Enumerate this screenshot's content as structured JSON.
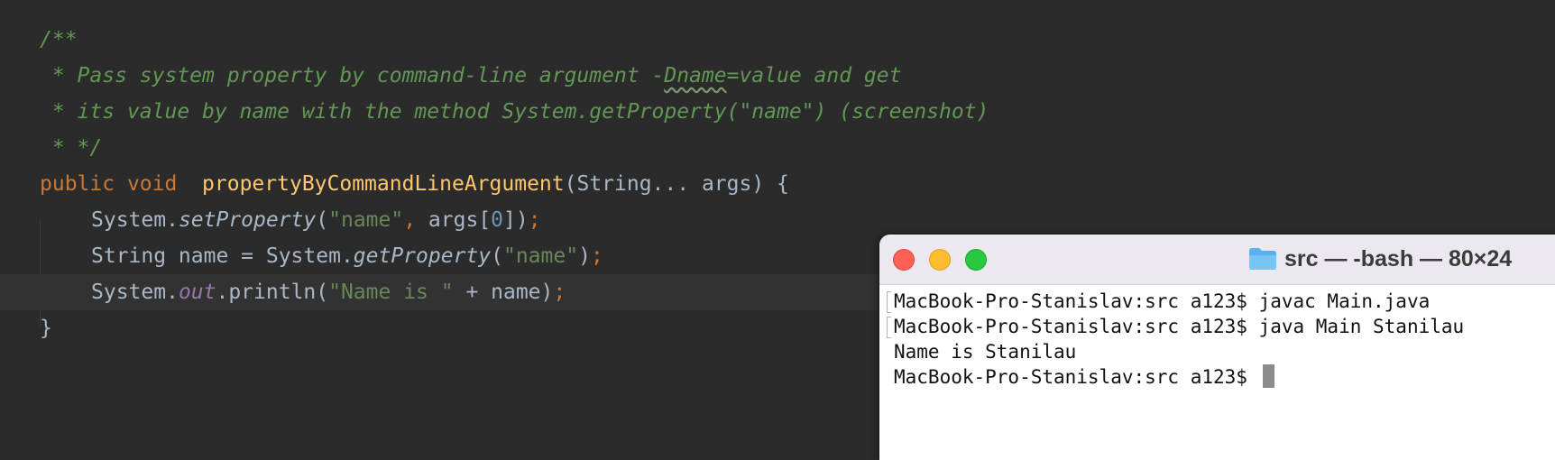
{
  "editor": {
    "comment": [
      "/**",
      " * Pass system property by command-line argument -",
      "Dname",
      "=value and get",
      " * its value by name with the method System.getProperty(\"name\") (screenshot)",
      " * */"
    ],
    "signature": {
      "kw_public": "public",
      "kw_void": "void",
      "method_name": "propertyByCommandLineArgument",
      "params": "(String... args) {"
    },
    "line_set": {
      "obj": "System.",
      "method": "setProperty",
      "open": "(",
      "str": "\"name\"",
      "comma": ",",
      "arg": " args[",
      "num": "0",
      "close": "])",
      "semi": ";"
    },
    "line_get": {
      "decl": "String name = System.",
      "method": "getProperty",
      "open": "(",
      "str": "\"name\"",
      "close": ")",
      "semi": ";"
    },
    "line_print": {
      "obj": "System.",
      "field": "out",
      "call": ".println(",
      "str": "\"Name is \"",
      "rest": " + name)",
      "semi": ";"
    },
    "closing_brace": "}"
  },
  "terminal": {
    "title": "src — -bash — 80×24",
    "lines": [
      "MacBook-Pro-Stanislav:src a123$ javac Main.java",
      "MacBook-Pro-Stanislav:src a123$ java Main Stanilau",
      "Name is Stanilau",
      "MacBook-Pro-Stanislav:src a123$ "
    ]
  },
  "colors": {
    "editor_bg": "#2b2b2b",
    "comment": "#629755",
    "keyword": "#cc7832",
    "function_name": "#ffc66d",
    "string": "#6a8759",
    "number": "#6897bb",
    "field": "#9876aa",
    "default_text": "#a9b7c6",
    "terminal_titlebar": "#ebe8ef",
    "traffic_close": "#fe5f57",
    "traffic_minimize": "#febc2e",
    "traffic_zoom": "#28c840",
    "folder_icon": "#5ab0ec"
  },
  "icons": [
    "folder-icon",
    "close-icon",
    "minimize-icon",
    "zoom-icon"
  ]
}
